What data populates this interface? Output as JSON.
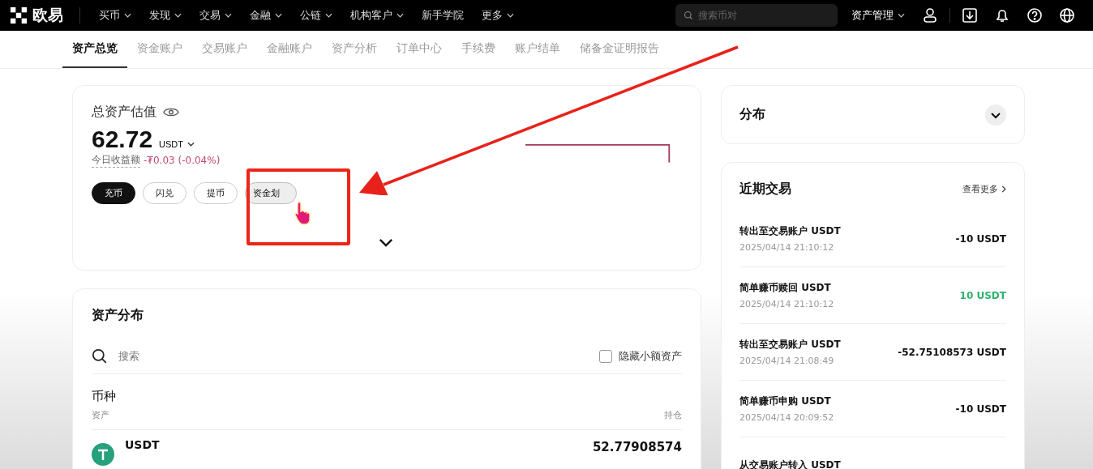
{
  "brand": "欧易",
  "nav": [
    {
      "label": "买币",
      "dropdown": true
    },
    {
      "label": "发现",
      "dropdown": true
    },
    {
      "label": "交易",
      "dropdown": true
    },
    {
      "label": "金融",
      "dropdown": true
    },
    {
      "label": "公链",
      "dropdown": true
    },
    {
      "label": "机构客户",
      "dropdown": true
    },
    {
      "label": "新手学院",
      "dropdown": false
    },
    {
      "label": "更多",
      "dropdown": true
    }
  ],
  "search": {
    "placeholder": "搜索币对"
  },
  "asset_menu": "资产管理",
  "tabs": [
    {
      "label": "资产总览",
      "selected": true
    },
    {
      "label": "资金账户",
      "selected": false
    },
    {
      "label": "交易账户",
      "selected": false
    },
    {
      "label": "金融账户",
      "selected": false
    },
    {
      "label": "资产分析",
      "selected": false
    },
    {
      "label": "订单中心",
      "selected": false
    },
    {
      "label": "手续费",
      "selected": false
    },
    {
      "label": "账户结单",
      "selected": false
    },
    {
      "label": "储备金证明报告",
      "selected": false
    }
  ],
  "overview": {
    "title": "总资产估值",
    "amount": "62.72",
    "currency": "USDT",
    "pnl_label": "今日收益额",
    "pnl": "-₮0.03 (-0.04%)",
    "actions": [
      {
        "label": "充币",
        "kind": "filled"
      },
      {
        "label": "闪兑",
        "kind": "outline"
      },
      {
        "label": "提币",
        "kind": "outline"
      },
      {
        "label": "资金划",
        "kind": "pressed"
      }
    ]
  },
  "distribution": {
    "title": "资产分布",
    "search_placeholder": "搜索",
    "hide_small": {
      "label": "隐藏小额资产",
      "checked": false
    },
    "section": "币种",
    "columns": [
      "资产",
      "持仓"
    ],
    "rows": [
      {
        "asset": "USDT",
        "holding": "52.77908574"
      }
    ]
  },
  "side_panel": {
    "title": "分布"
  },
  "recent": {
    "title": "近期交易",
    "more": "查看更多",
    "items": [
      {
        "title": "转出至交易账户 USDT",
        "time": "2025/04/14 21:10:12",
        "amount": "-10 USDT",
        "positive": false
      },
      {
        "title": "简单赚币赎回 USDT",
        "time": "2025/04/14 21:10:12",
        "amount": "10 USDT",
        "positive": true
      },
      {
        "title": "转出至交易账户 USDT",
        "time": "2025/04/14 21:08:49",
        "amount": "-52.75108573 USDT",
        "positive": false
      },
      {
        "title": "简单赚币申购 USDT",
        "time": "2025/04/14 20:09:52",
        "amount": "-10 USDT",
        "positive": false
      },
      {
        "title": "从交易账户转入 USDT"
      }
    ]
  }
}
